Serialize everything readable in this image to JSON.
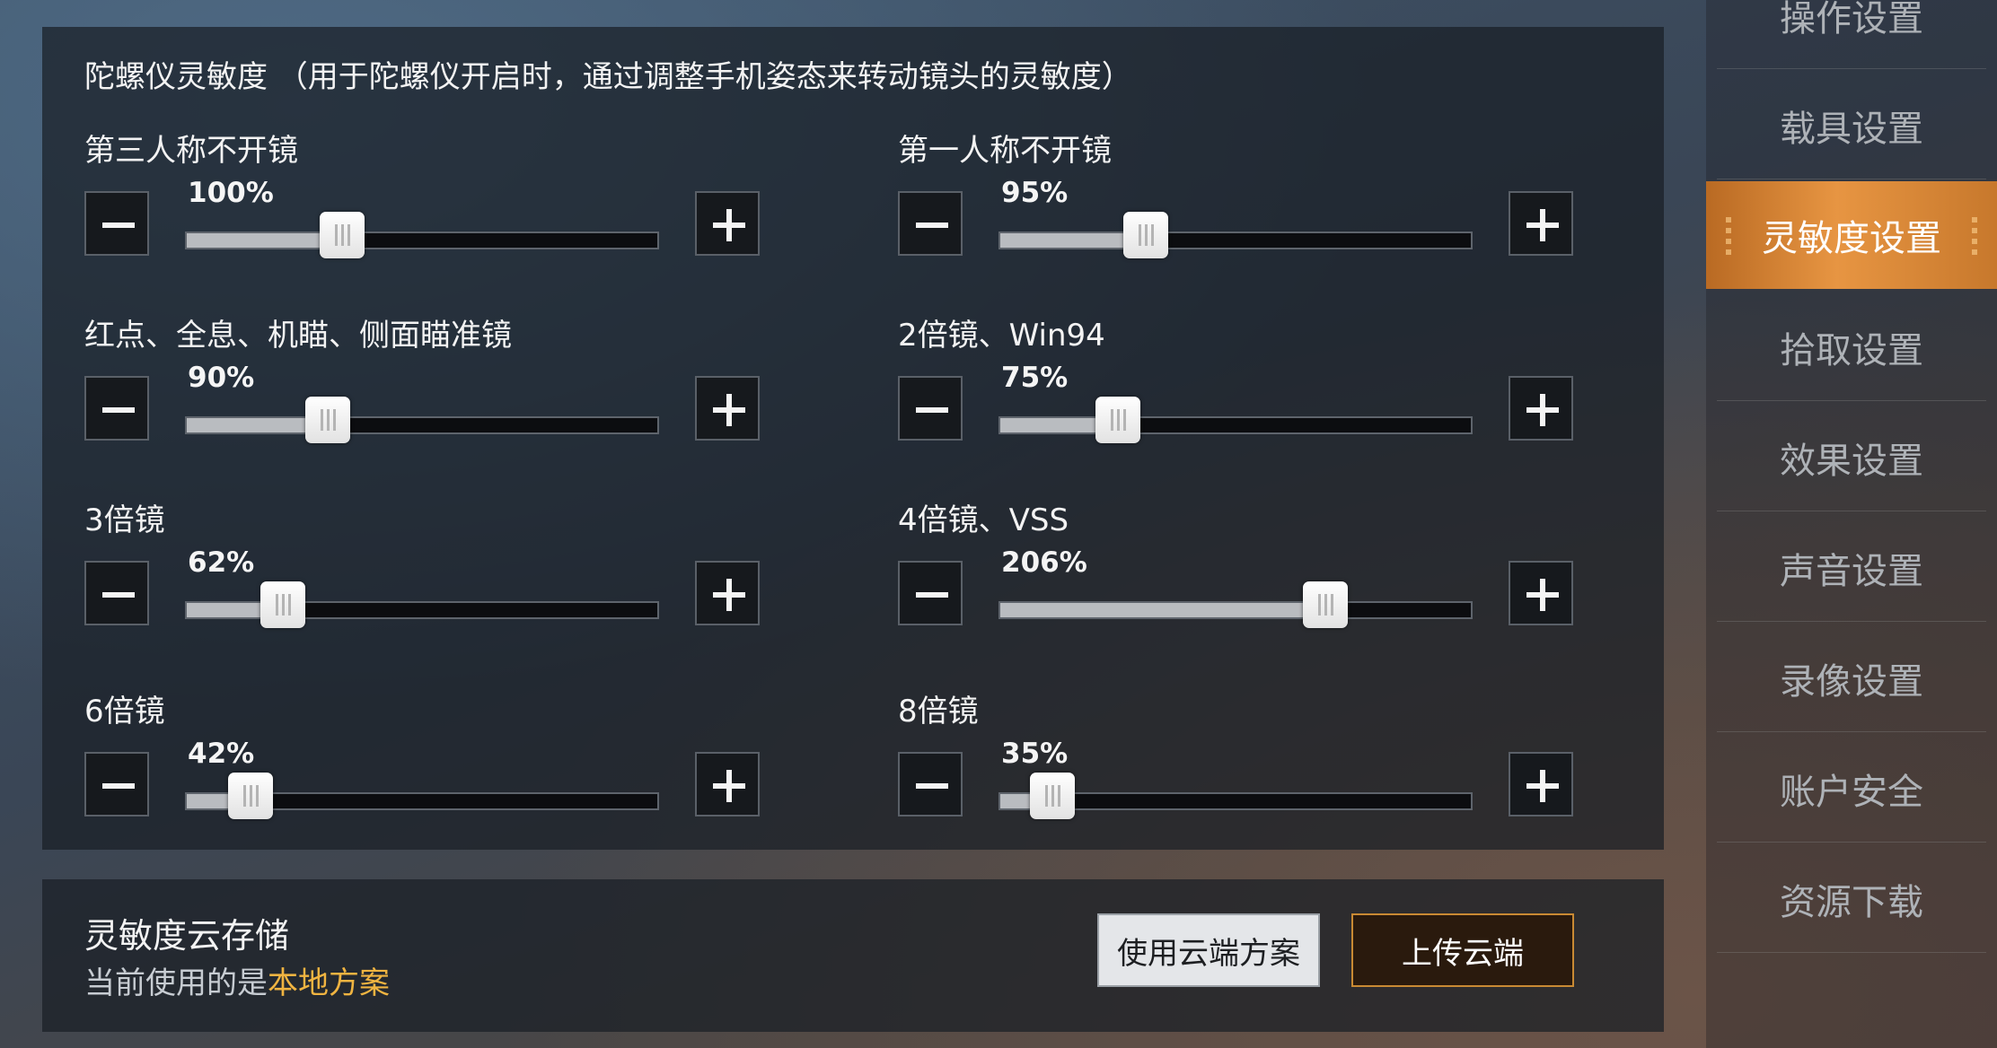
{
  "gyro": {
    "heading": "陀螺仪灵敏度 （用于陀螺仪开启时，通过调整手机姿态来转动镜头的灵敏度）",
    "sliders": [
      {
        "label": "第三人称不开镜",
        "percent": "100%",
        "fraction": 0.33
      },
      {
        "label": "第一人称不开镜",
        "percent": "95%",
        "fraction": 0.31
      },
      {
        "label": "红点、全息、机瞄、侧面瞄准镜",
        "percent": "90%",
        "fraction": 0.3
      },
      {
        "label": "2倍镜、Win94",
        "percent": "75%",
        "fraction": 0.25
      },
      {
        "label": "3倍镜",
        "percent": "62%",
        "fraction": 0.205
      },
      {
        "label": "4倍镜、VSS",
        "percent": "206%",
        "fraction": 0.69
      },
      {
        "label": "6倍镜",
        "percent": "42%",
        "fraction": 0.135
      },
      {
        "label": "8倍镜",
        "percent": "35%",
        "fraction": 0.11
      }
    ]
  },
  "cloud": {
    "title": "灵敏度云存储",
    "current_prefix": "当前使用的是",
    "current_value": "本地方案",
    "use_cloud_label": "使用云端方案",
    "upload_label": "上传云端"
  },
  "sidebar": {
    "items": [
      {
        "label": "操作设置"
      },
      {
        "label": "载具设置"
      },
      {
        "label": "灵敏度设置"
      },
      {
        "label": "拾取设置"
      },
      {
        "label": "效果设置"
      },
      {
        "label": "声音设置"
      },
      {
        "label": "录像设置"
      },
      {
        "label": "账户安全"
      },
      {
        "label": "资源下载"
      }
    ],
    "active_index": 2
  },
  "colors": {
    "accent_orange": "#e79542",
    "highlight_text": "#f0b441",
    "upload_border": "#c98a33"
  }
}
